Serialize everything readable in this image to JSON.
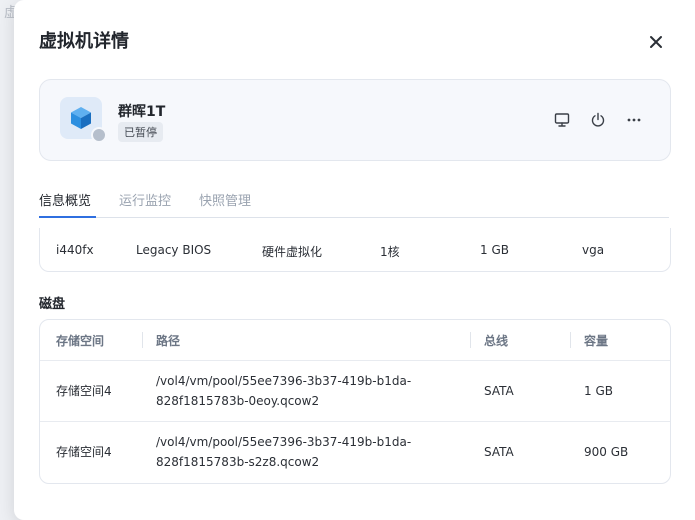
{
  "background": {
    "text": "虚"
  },
  "modal": {
    "title": "虚拟机详情"
  },
  "vm": {
    "name": "群晖1T",
    "status": "已暂停"
  },
  "icons": {
    "vm": "cube-icon",
    "close": "close-icon",
    "console": "monitor-icon",
    "power": "power-icon",
    "more": "more-icon"
  },
  "tabs": [
    {
      "label": "信息概览",
      "active": true
    },
    {
      "label": "运行监控",
      "active": false
    },
    {
      "label": "快照管理",
      "active": false
    }
  ],
  "info": {
    "chipset": "i440fx",
    "firmware": "Legacy BIOS",
    "virtualization": "硬件虚拟化",
    "cpu": "1核",
    "memory": "1 GB",
    "display": "vga"
  },
  "disk": {
    "title": "磁盘",
    "headers": {
      "storage": "存储空间",
      "path": "路径",
      "bus": "总线",
      "capacity": "容量"
    },
    "rows": [
      {
        "storage": "存储空间4",
        "path_line1": "/vol4/vm/pool/55ee7396-3b37-419b-b1da-",
        "path_line2": "828f1815783b-0eoy.qcow2",
        "bus": "SATA",
        "capacity": "1 GB"
      },
      {
        "storage": "存储空间4",
        "path_line1": "/vol4/vm/pool/55ee7396-3b37-419b-b1da-",
        "path_line2": "828f1815783b-s2z8.qcow2",
        "bus": "SATA",
        "capacity": "900 GB"
      }
    ]
  },
  "colors": {
    "accent": "#2f6fe0",
    "cube": "#2c8fe0",
    "status_dot": "#b6bfcc"
  }
}
